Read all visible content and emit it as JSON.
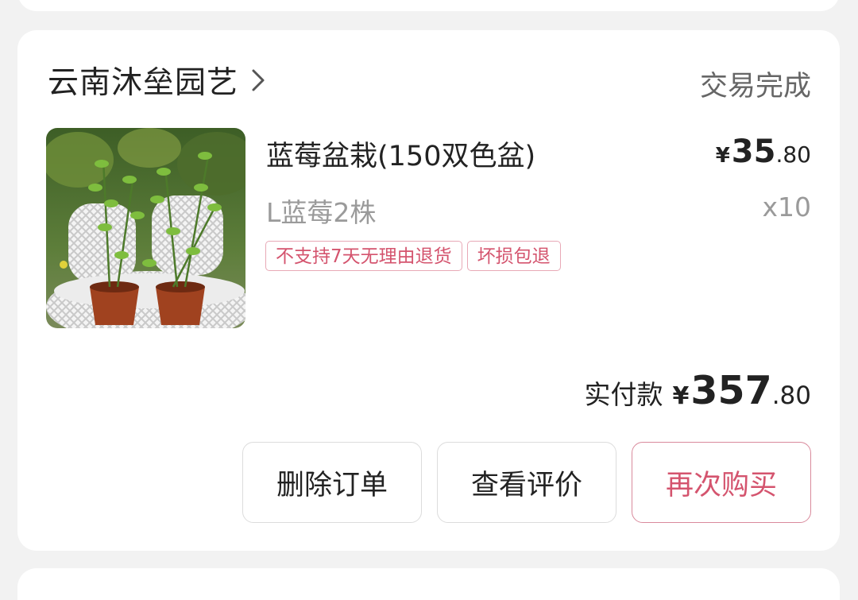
{
  "order": {
    "shop_name": "云南沐垒园艺",
    "status": "交易完成",
    "product": {
      "title": "蓝莓盆栽(150双色盆)",
      "price_symbol": "¥",
      "price_int": "35",
      "price_dec": ".80",
      "spec": "L蓝莓2株",
      "quantity": "x10",
      "image_alt": "蓝莓盆栽"
    },
    "tags": [
      "不支持7天无理由退货",
      "坏损包退"
    ],
    "total": {
      "label": "实付款",
      "symbol": "¥",
      "int": "357",
      "dec": ".80"
    },
    "actions": {
      "delete": "删除订单",
      "review": "查看评价",
      "rebuy": "再次购买"
    }
  },
  "colors": {
    "accent": "#d4546e",
    "accent_border": "#d98a9c",
    "tag_border": "#e8a9b6",
    "background": "#f2f2f2",
    "card": "#ffffff"
  },
  "icons": {
    "shop_chevron": "chevron-right-icon"
  }
}
